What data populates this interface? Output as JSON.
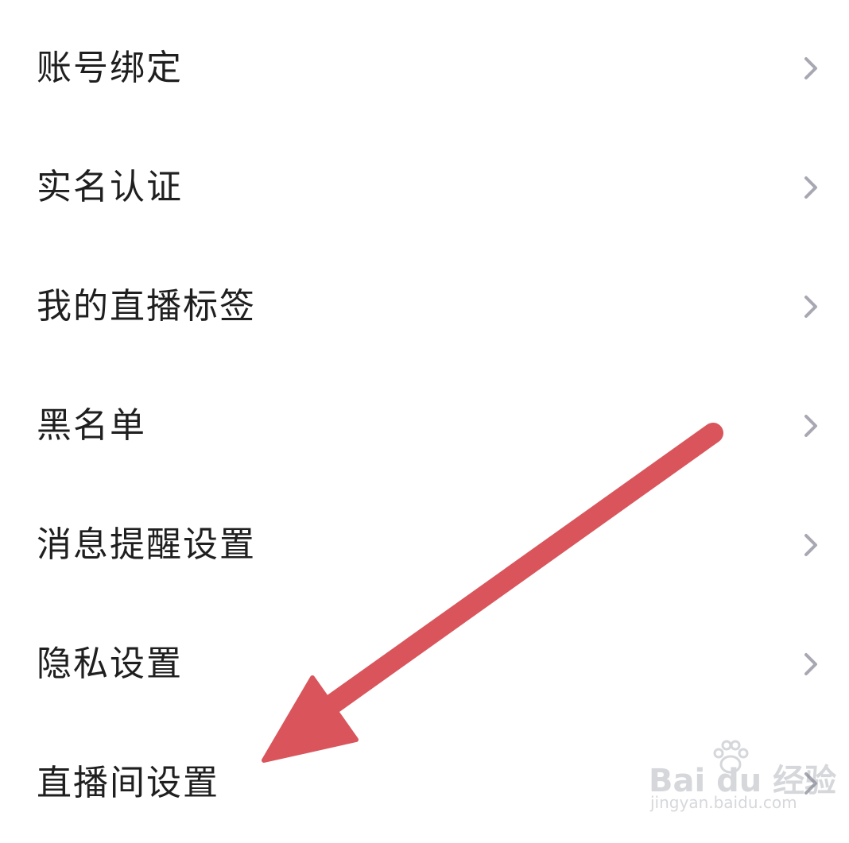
{
  "settings": {
    "items": [
      {
        "label": "账号绑定",
        "icon": "chevron-right-icon"
      },
      {
        "label": "实名认证",
        "icon": "chevron-right-icon"
      },
      {
        "label": "我的直播标签",
        "icon": "chevron-right-icon"
      },
      {
        "label": "黑名单",
        "icon": "chevron-right-icon"
      },
      {
        "label": "消息提醒设置",
        "icon": "chevron-right-icon"
      },
      {
        "label": "隐私设置",
        "icon": "chevron-right-icon"
      },
      {
        "label": "直播间设置",
        "icon": "chevron-right-icon"
      }
    ]
  },
  "annotation": {
    "type": "arrow",
    "color": "#d9555b",
    "points_to": "直播间设置"
  },
  "watermark": {
    "brand": "Bai du 经验",
    "sub": "jingyan.baidu.com"
  },
  "colors": {
    "background": "#ffffff",
    "text": "#1f1f1f",
    "chevron": "#a8a8b3"
  }
}
